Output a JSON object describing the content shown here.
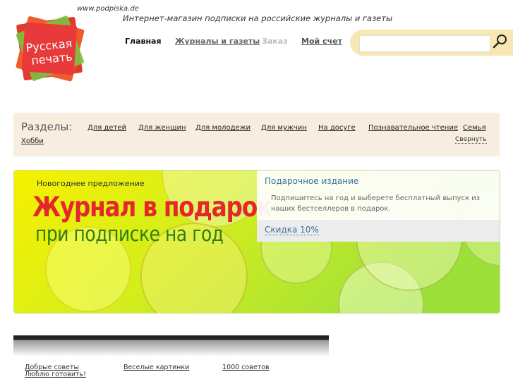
{
  "header": {
    "logo_text_line1": "Русская",
    "logo_text_line2": "печать",
    "site_url": "www.podpiska.de",
    "tagline": "Интернет-магазин подписки на российские журналы и газеты",
    "nav": {
      "home": "Главная",
      "magazines": "Журналы и газеты",
      "order": "Заказ",
      "account": "Мой счет"
    },
    "search": {
      "placeholder": "",
      "icon": "search-icon"
    }
  },
  "sections": {
    "title": "Разделы:",
    "items": [
      "Для детей",
      "Для женщин",
      "Для молодежи",
      "Для мужчин",
      "На досуге",
      "Познавательное чтение",
      "Семья",
      "Хобби"
    ],
    "collapse": "Свернуть"
  },
  "banner": {
    "kicker": "Новогоднее предложение",
    "headline": "Журнал в подарок",
    "subline": "при подписке на год",
    "offer_title": "Подарочное издание",
    "offer_description": "Подпишитесь на год и выберете бесплатный выпуск из наших бестселлеров в подарок.",
    "discount": "Скидка 10%"
  },
  "footer_links": [
    "Добрые советы",
    "Веселые картинки",
    "1000 советов",
    "Люблю готовить!"
  ],
  "colors": {
    "accent_red": "#e4262d",
    "accent_green": "#2e7d16",
    "link_blue": "#3d6ea3",
    "sections_bg": "#f8eee0"
  }
}
